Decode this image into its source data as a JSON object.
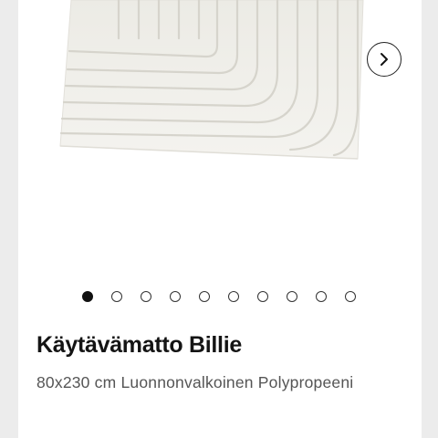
{
  "product": {
    "title": "Käytävämatto Billie",
    "description": "80x230 cm Luonnonvalkoinen Polypropeeni"
  },
  "gallery": {
    "image_alt": "rug-image",
    "next_icon": "chevron-right-icon",
    "slide_count": 10,
    "active_index": 0
  },
  "colors": {
    "rug": "#f1f0eb",
    "rug_lines": "#d8d6cf",
    "card_background": "#ffffff",
    "page_background": "#ececec",
    "active_dot": "#111111"
  }
}
